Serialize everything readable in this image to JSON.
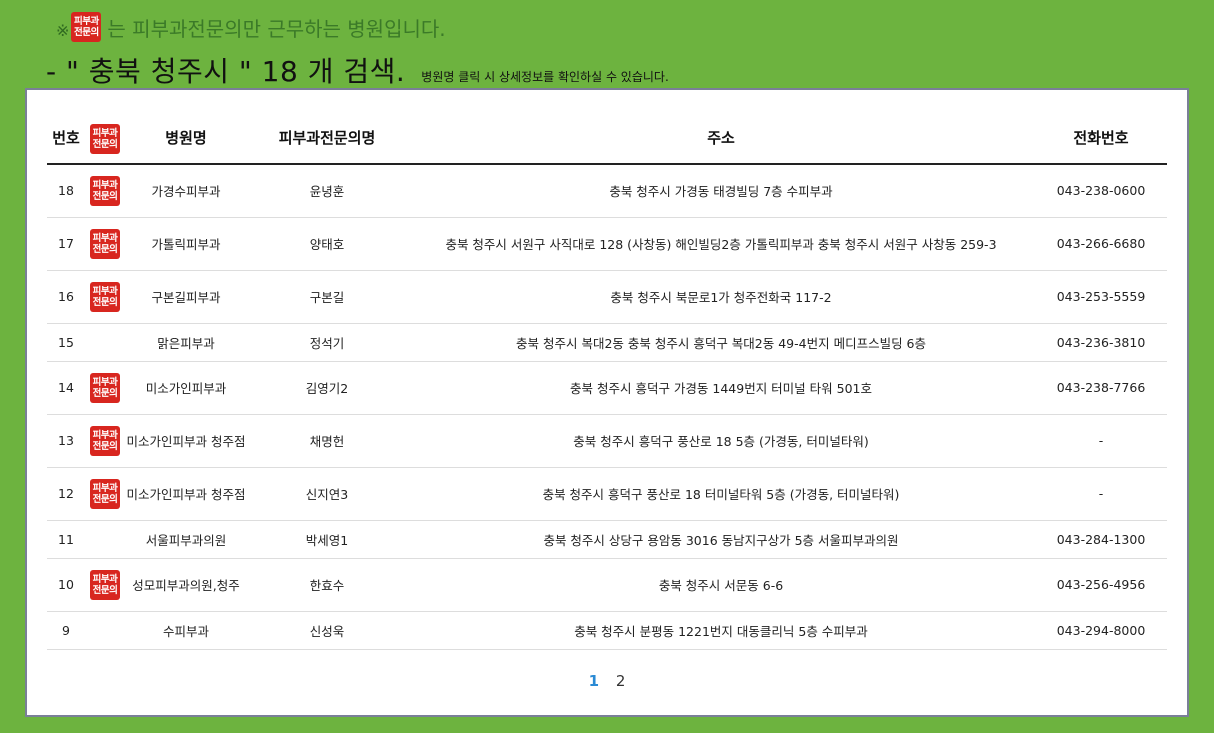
{
  "notice": {
    "mark": "※",
    "badge": [
      "피부과",
      "전문의"
    ],
    "text": "는 피부과전문의만 근무하는 병원입니다."
  },
  "search": {
    "title": "- \" 충북 청주시 \" 18 개 검색.",
    "hint": "병원명 클릭 시 상세정보를 확인하실 수 있습니다."
  },
  "table": {
    "headers": {
      "no": "번호",
      "badge": [
        "피부과",
        "전문의"
      ],
      "name": "병원명",
      "doctor": "피부과전문의명",
      "address": "주소",
      "phone": "전화번호"
    },
    "rows": [
      {
        "no": "18",
        "specialist": true,
        "name": "가경수피부과",
        "doctor": "윤녕훈",
        "address": "충북 청주시 가경동 태경빌딩 7층 수피부과",
        "phone": "043-238-0600"
      },
      {
        "no": "17",
        "specialist": true,
        "name": "가톨릭피부과",
        "doctor": "양태호",
        "address": "충북 청주시 서원구 사직대로 128 (사창동) 해인빌딩2층 가톨릭피부과 충북 청주시 서원구 사창동 259-3",
        "phone": "043-266-6680"
      },
      {
        "no": "16",
        "specialist": true,
        "name": "구본길피부과",
        "doctor": "구본길",
        "address": "충북 청주시 북문로1가 청주전화국 117-2",
        "phone": "043-253-5559"
      },
      {
        "no": "15",
        "specialist": false,
        "name": "맑은피부과",
        "doctor": "정석기",
        "address": "충북 청주시 복대2동 충북 청주시 흥덕구 복대2동 49-4번지 메디프스빌딩 6층",
        "phone": "043-236-3810"
      },
      {
        "no": "14",
        "specialist": true,
        "name": "미소가인피부과",
        "doctor": "김영기2",
        "address": "충북 청주시 흥덕구 가경동 1449번지 터미널 타워 501호",
        "phone": "043-238-7766"
      },
      {
        "no": "13",
        "specialist": true,
        "name": "미소가인피부과 청주점",
        "doctor": "채명헌",
        "address": "충북 청주시 흥덕구 풍산로 18 5층 (가경동, 터미널타워)",
        "phone": "-"
      },
      {
        "no": "12",
        "specialist": true,
        "name": "미소가인피부과 청주점",
        "doctor": "신지연3",
        "address": "충북 청주시 흥덕구 풍산로 18 터미널타워 5층 (가경동, 터미널타워)",
        "phone": "-"
      },
      {
        "no": "11",
        "specialist": false,
        "name": "서울피부과의원",
        "doctor": "박세영1",
        "address": "충북 청주시 상당구 용암동 3016 동남지구상가 5층 서울피부과의원",
        "phone": "043-284-1300"
      },
      {
        "no": "10",
        "specialist": true,
        "name": "성모피부과의원,청주",
        "doctor": "한효수",
        "address": "충북 청주시 서문동 6-6",
        "phone": "043-256-4956"
      },
      {
        "no": "9",
        "specialist": false,
        "name": "수피부과",
        "doctor": "신성욱",
        "address": "충북 청주시 분평동 1221번지 대동클리닉 5층 수피부과",
        "phone": "043-294-8000"
      }
    ]
  },
  "pagination": {
    "current": "1",
    "pages": [
      "2"
    ]
  },
  "colors": {
    "background": "#6db33f",
    "badge": "#d8261f",
    "current_page": "#2a8ad4"
  }
}
